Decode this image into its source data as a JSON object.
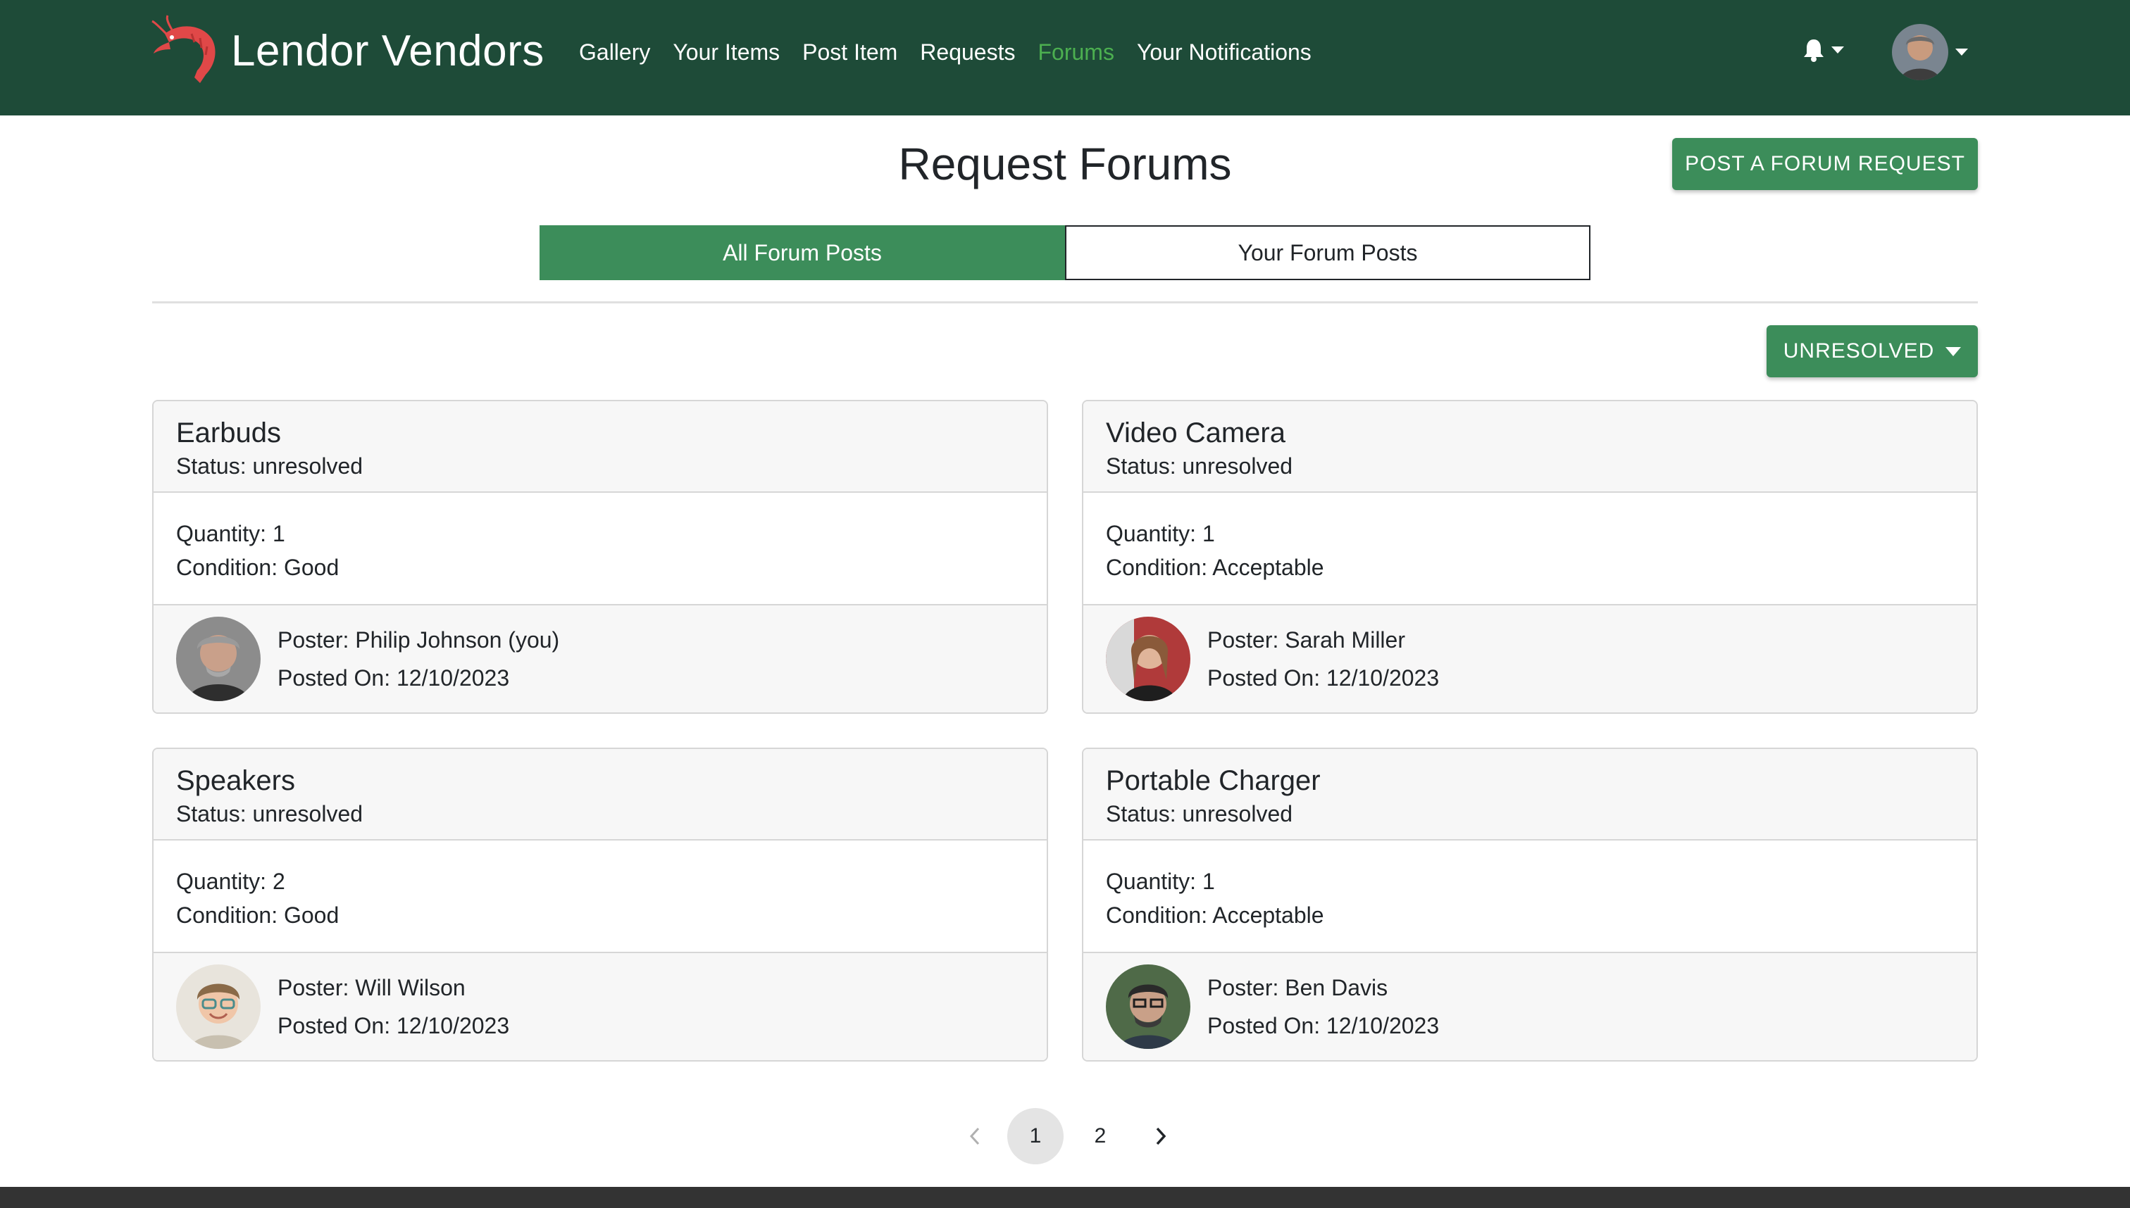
{
  "navbar": {
    "brand": "Lendor Vendors",
    "links": [
      {
        "label": "Gallery",
        "active": false
      },
      {
        "label": "Your Items",
        "active": false
      },
      {
        "label": "Post Item",
        "active": false
      },
      {
        "label": "Requests",
        "active": false
      },
      {
        "label": "Forums",
        "active": true
      },
      {
        "label": "Your Notifications",
        "active": false
      }
    ],
    "icons": {
      "logo": "shrimp-logo",
      "notifications": "bell-icon",
      "profile": "user-avatar"
    }
  },
  "page": {
    "title": "Request Forums",
    "post_button": "POST A FORUM REQUEST",
    "tabs": [
      {
        "label": "All Forum Posts",
        "active": true
      },
      {
        "label": "Your Forum Posts",
        "active": false
      }
    ],
    "filter_button": "UNRESOLVED"
  },
  "cards": [
    {
      "title": "Earbuds",
      "status": "Status: unresolved",
      "quantity": "Quantity: 1",
      "condition": "Condition: Good",
      "poster": "Poster: Philip Johnson (you)",
      "posted_on": "Posted On: 12/10/2023"
    },
    {
      "title": "Video Camera",
      "status": "Status: unresolved",
      "quantity": "Quantity: 1",
      "condition": "Condition: Acceptable",
      "poster": "Poster: Sarah Miller",
      "posted_on": "Posted On: 12/10/2023"
    },
    {
      "title": "Speakers",
      "status": "Status: unresolved",
      "quantity": "Quantity: 2",
      "condition": "Condition: Good",
      "poster": "Poster: Will Wilson",
      "posted_on": "Posted On: 12/10/2023"
    },
    {
      "title": "Portable Charger",
      "status": "Status: unresolved",
      "quantity": "Quantity: 1",
      "condition": "Condition: Acceptable",
      "poster": "Poster: Ben Davis",
      "posted_on": "Posted On: 12/10/2023"
    }
  ],
  "pagination": {
    "pages": [
      "1",
      "2"
    ],
    "current": "1"
  },
  "colors": {
    "navbar_bg": "#1e4b38",
    "accent_green": "#3c8d5a",
    "active_link": "#4caf50",
    "footer": "#333333"
  }
}
